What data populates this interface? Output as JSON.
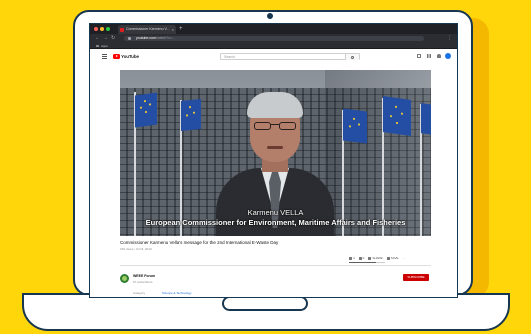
{
  "colors": {
    "background": "#ffd60a",
    "laptop_outline": "#17364f",
    "brand_red": "#ff0000",
    "subscribe_red": "#cc0000",
    "flag_blue": "#234ea3"
  },
  "browser": {
    "window_controls": [
      "close",
      "minimize",
      "maximize"
    ],
    "tab": {
      "title": "Commissioner Karmenu V..."
    },
    "url": {
      "host": "youtube.com",
      "path": "/watch?v=..."
    },
    "bookmark": "Apps"
  },
  "youtube": {
    "logo_text": "YouTube",
    "search_placeholder": "Search"
  },
  "video": {
    "subtitle_line_1": "Karmenu VELLA",
    "subtitle_line_2": "European Commissioner for Environment, Maritime Affairs and Fisheries",
    "title": "Commissioner Karmenu Vella's message for the 2nd International E-Waste Day",
    "meta": "150 views • Oct 8, 2019",
    "actions": {
      "likes": "4",
      "dislikes": "0",
      "share": "SHARE",
      "save": "SAVE",
      "more": "..."
    },
    "rating_fraction": 0.75
  },
  "channel": {
    "name": "WEEE Forum",
    "subscribers": "67 subscribers",
    "subscribe_label": "SUBSCRIBE",
    "category_label": "Category",
    "category_value": "Science & Technology"
  }
}
